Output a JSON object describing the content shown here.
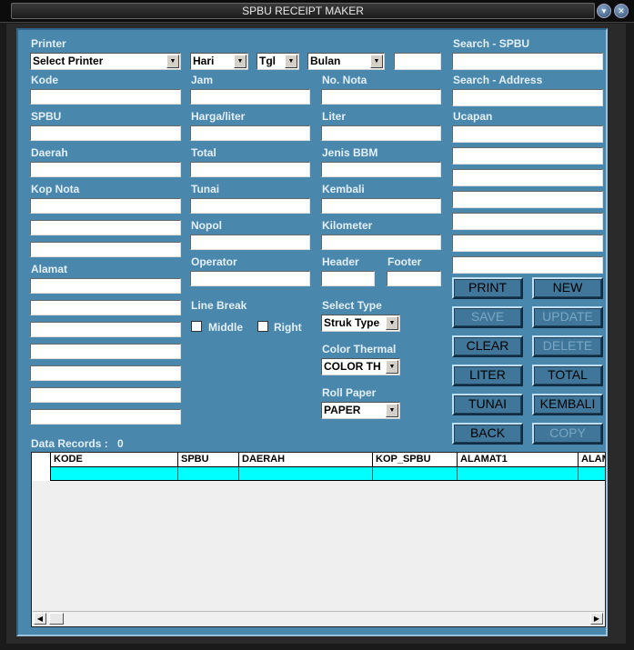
{
  "window": {
    "title": "SPBU RECEIPT MAKER"
  },
  "labels": {
    "printer": "Printer",
    "kode": "Kode",
    "spbu": "SPBU",
    "daerah": "Daerah",
    "kop_nota": "Kop Nota",
    "alamat": "Alamat",
    "jam": "Jam",
    "harga_liter": "Harga/liter",
    "total": "Total",
    "tunai": "Tunai",
    "nopol": "Nopol",
    "operator": "Operator",
    "line_break": "Line Break",
    "middle": "Middle",
    "right": "Right",
    "no_nota": "No. Nota",
    "liter": "Liter",
    "jenis_bbm": "Jenis BBM",
    "kembali": "Kembali",
    "kilometer": "Kilometer",
    "header": "Header",
    "footer": "Footer",
    "select_type": "Select Type",
    "color_thermal": "Color Thermal",
    "roll_paper": "Roll Paper",
    "search_spbu": "Search - SPBU",
    "search_address": "Search -  Address",
    "ucapan": "Ucapan",
    "data_records": "Data Records :",
    "data_records_count": "0"
  },
  "combos": {
    "printer": "Select Printer",
    "hari": "Hari",
    "tgl": "Tgl",
    "bulan": "Bulan",
    "select_type": "Struk Type",
    "color_thermal": "COLOR TH",
    "roll_paper": "PAPER"
  },
  "buttons": {
    "print": "PRINT",
    "new": "NEW",
    "save": "SAVE",
    "update": "UPDATE",
    "clear": "CLEAR",
    "delete": "DELETE",
    "liter": "LITER",
    "total": "TOTAL",
    "tunai": "TUNAI",
    "kembali": "KEMBALI",
    "back": "BACK",
    "copy": "COPY"
  },
  "grid": {
    "columns": [
      "KODE",
      "SPBU",
      "DAERAH",
      "KOP_SPBU",
      "ALAMAT1",
      "ALAM"
    ]
  }
}
